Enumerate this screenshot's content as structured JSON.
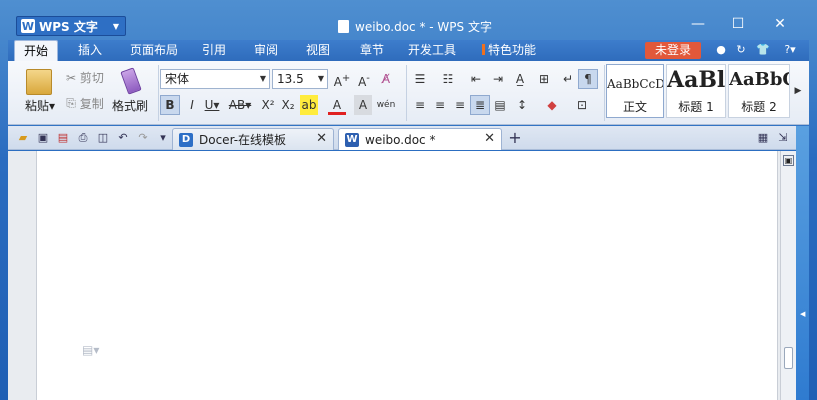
{
  "app": {
    "name": "WPS 文字"
  },
  "window": {
    "title": "weibo.doc * - WPS 文字",
    "min": "—",
    "max": "☐",
    "close": "✕"
  },
  "menu": {
    "tabs": [
      "开始",
      "插入",
      "页面布局",
      "引用",
      "审阅",
      "视图",
      "章节",
      "开发工具",
      "特色功能"
    ],
    "active": "开始",
    "login": "未登录"
  },
  "ribbon": {
    "paste": "粘贴",
    "cut": "剪切",
    "copy": "复制",
    "format_painter": "格式刷",
    "font_name": "宋体",
    "font_size": "13.5",
    "styles": [
      {
        "sample": "AaBbCcDd",
        "label": "正文"
      },
      {
        "sample": "AaBl",
        "label": "标题 1"
      },
      {
        "sample": "AaBbC",
        "label": "标题 2"
      }
    ]
  },
  "doc_tabs": [
    {
      "label": "Docer-在线模板",
      "active": false
    },
    {
      "label": "weibo.doc *",
      "active": true
    }
  ],
  "new_tab": "+",
  "colors": {
    "title_bg": "#2a6cc0",
    "login_btn": "#e2583a",
    "accent": "#2e6fc4"
  }
}
